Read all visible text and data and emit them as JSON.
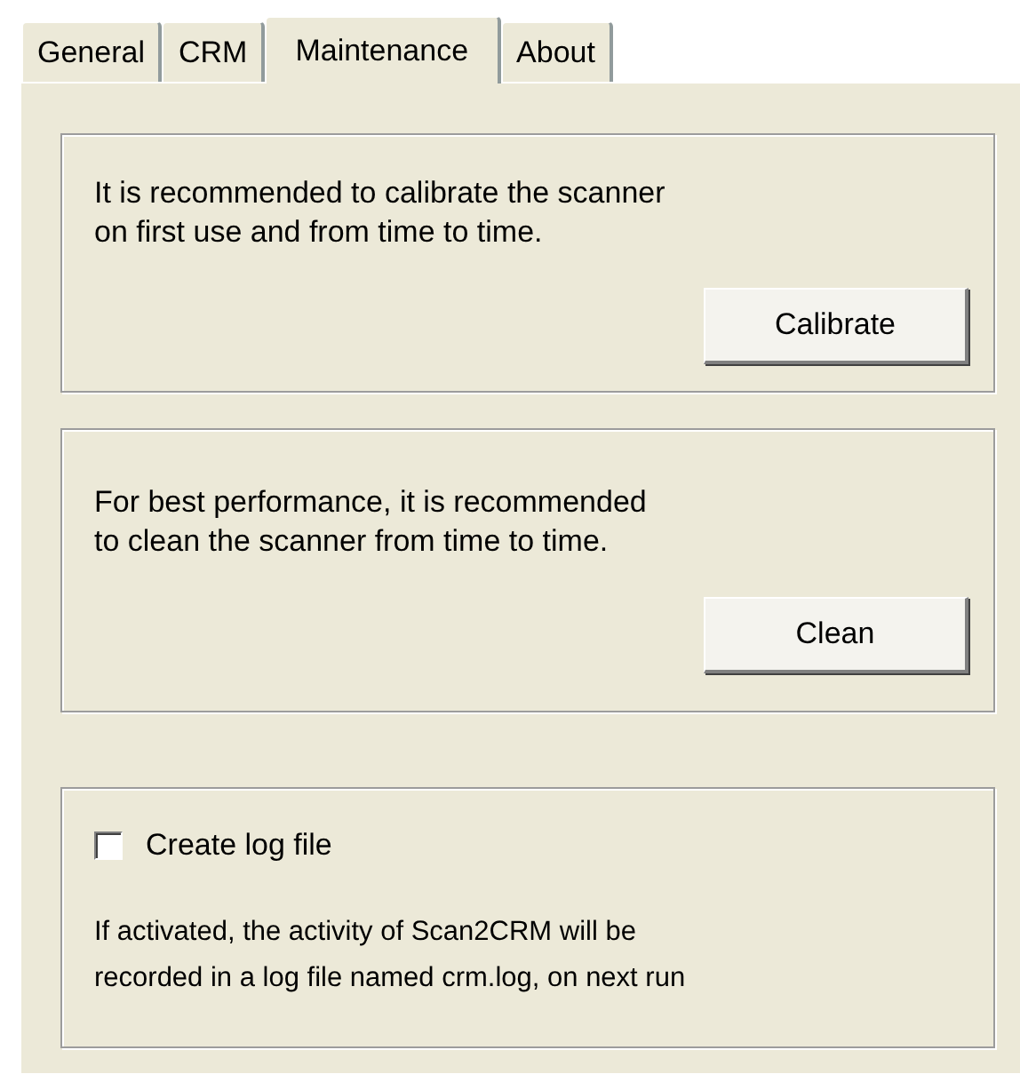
{
  "tabs": [
    {
      "label": "General",
      "selected": false
    },
    {
      "label": "CRM",
      "selected": false
    },
    {
      "label": "Maintenance",
      "selected": true
    },
    {
      "label": "About",
      "selected": false
    }
  ],
  "groups": [
    {
      "kind": "action",
      "lines": [
        "It is recommended to calibrate the scanner",
        "on first use and from time to time."
      ],
      "button": "Calibrate"
    },
    {
      "kind": "action",
      "lines": [
        "For best performance, it is recommended",
        "to clean the scanner from time to time."
      ],
      "button": "Clean"
    },
    {
      "kind": "option",
      "checkbox": {
        "label": "Create log file",
        "checked": false
      },
      "lines": [
        "If activated, the activity of Scan2CRM will be",
        "recorded in a log file named crm.log, on next run"
      ]
    }
  ]
}
